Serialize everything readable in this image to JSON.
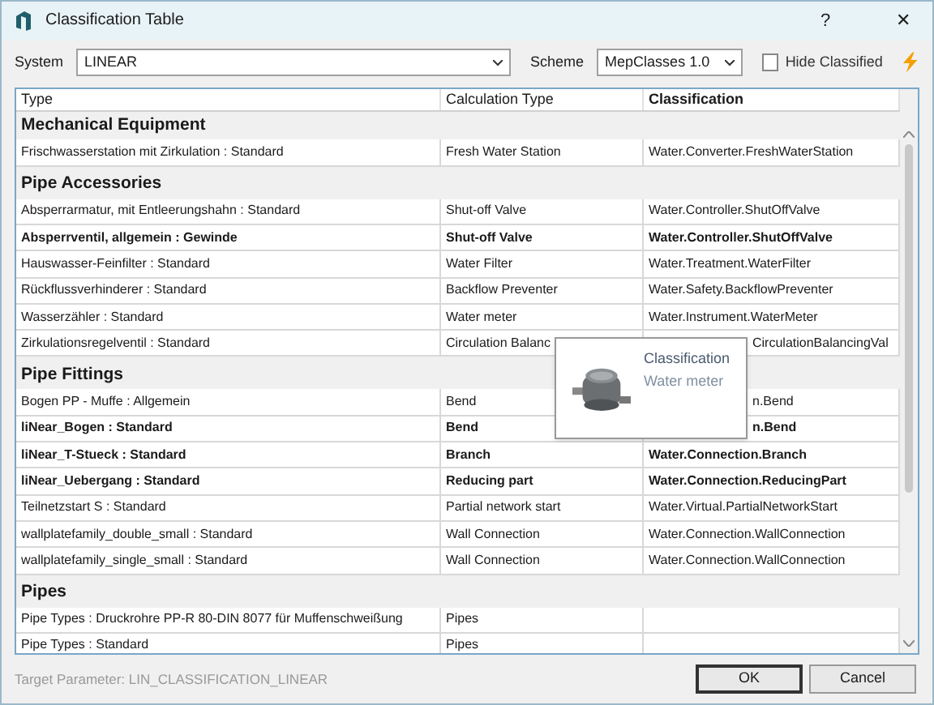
{
  "window": {
    "title": "Classification Table",
    "help": "?",
    "close": "✕"
  },
  "toolbar": {
    "system_label": "System",
    "system_value": "LINEAR",
    "scheme_label": "Scheme",
    "scheme_value": "MepClasses 1.0",
    "hide_classified": {
      "label": "Hide Classified",
      "checked": false
    }
  },
  "table": {
    "columns": [
      "Type",
      "Calculation Type",
      "Classification"
    ],
    "groups": [
      {
        "name": "Mechanical Equipment",
        "rows": [
          {
            "type": "Frischwasserstation mit Zirkulation : Standard",
            "calculation_type": "Fresh Water Station",
            "classification": "Water.Converter.FreshWaterStation",
            "bold": false
          }
        ]
      },
      {
        "name": "Pipe Accessories",
        "rows": [
          {
            "type": "Absperrarmatur, mit Entleerungshahn : Standard",
            "calculation_type": "Shut-off Valve",
            "classification": "Water.Controller.ShutOffValve",
            "bold": false
          },
          {
            "type": "Absperrventil, allgemein : Gewinde",
            "calculation_type": "Shut-off Valve",
            "classification": "Water.Controller.ShutOffValve",
            "bold": true
          },
          {
            "type": "Hauswasser-Feinfilter : Standard",
            "calculation_type": "Water Filter",
            "classification": "Water.Treatment.WaterFilter",
            "bold": false
          },
          {
            "type": "Rückflussverhinderer : Standard",
            "calculation_type": "Backflow Preventer",
            "classification": "Water.Safety.BackflowPreventer",
            "bold": false
          },
          {
            "type": "Wasserzähler : Standard",
            "calculation_type": "Water meter",
            "classification": "Water.Instrument.WaterMeter",
            "bold": false
          },
          {
            "type": "Zirkulationsregelventil : Standard",
            "calculation_type": "Circulation Balanc",
            "classification": "CirculationBalancingVal",
            "classification_under_tooltip": true,
            "bold": false
          }
        ]
      },
      {
        "name": "Pipe Fittings",
        "rows": [
          {
            "type": "Bogen PP - Muffe : Allgemein",
            "calculation_type": "Bend",
            "classification": "n.Bend",
            "classification_under_tooltip": true,
            "bold": false
          },
          {
            "type": "liNear_Bogen : Standard",
            "calculation_type": "Bend",
            "classification": "n.Bend",
            "classification_under_tooltip": true,
            "bold": true
          },
          {
            "type": "liNear_T-Stueck : Standard",
            "calculation_type": "Branch",
            "classification": "Water.Connection.Branch",
            "bold": true
          },
          {
            "type": "liNear_Uebergang : Standard",
            "calculation_type": "Reducing part",
            "classification": "Water.Connection.ReducingPart",
            "bold": true
          },
          {
            "type": "Teilnetzstart S : Standard",
            "calculation_type": "Partial network start",
            "classification": "Water.Virtual.PartialNetworkStart",
            "bold": false
          },
          {
            "type": "wallplatefamily_double_small : Standard",
            "calculation_type": "Wall Connection",
            "classification": "Water.Connection.WallConnection",
            "bold": false
          },
          {
            "type": "wallplatefamily_single_small : Standard",
            "calculation_type": "Wall Connection",
            "classification": "Water.Connection.WallConnection",
            "bold": false
          }
        ]
      },
      {
        "name": "Pipes",
        "rows": [
          {
            "type": "Pipe Types : Druckrohre PP-R 80-DIN 8077 für Muffenschweißung",
            "calculation_type": "Pipes",
            "bold": false
          },
          {
            "type": "Pipe Types : Standard",
            "calculation_type": "Pipes",
            "bold": false
          }
        ]
      }
    ]
  },
  "tooltip": {
    "title": "Classification",
    "value": "Water meter"
  },
  "footer": {
    "target_parameter": "Target Parameter: LIN_CLASSIFICATION_LINEAR",
    "buttons": [
      "OK",
      "Cancel"
    ]
  }
}
